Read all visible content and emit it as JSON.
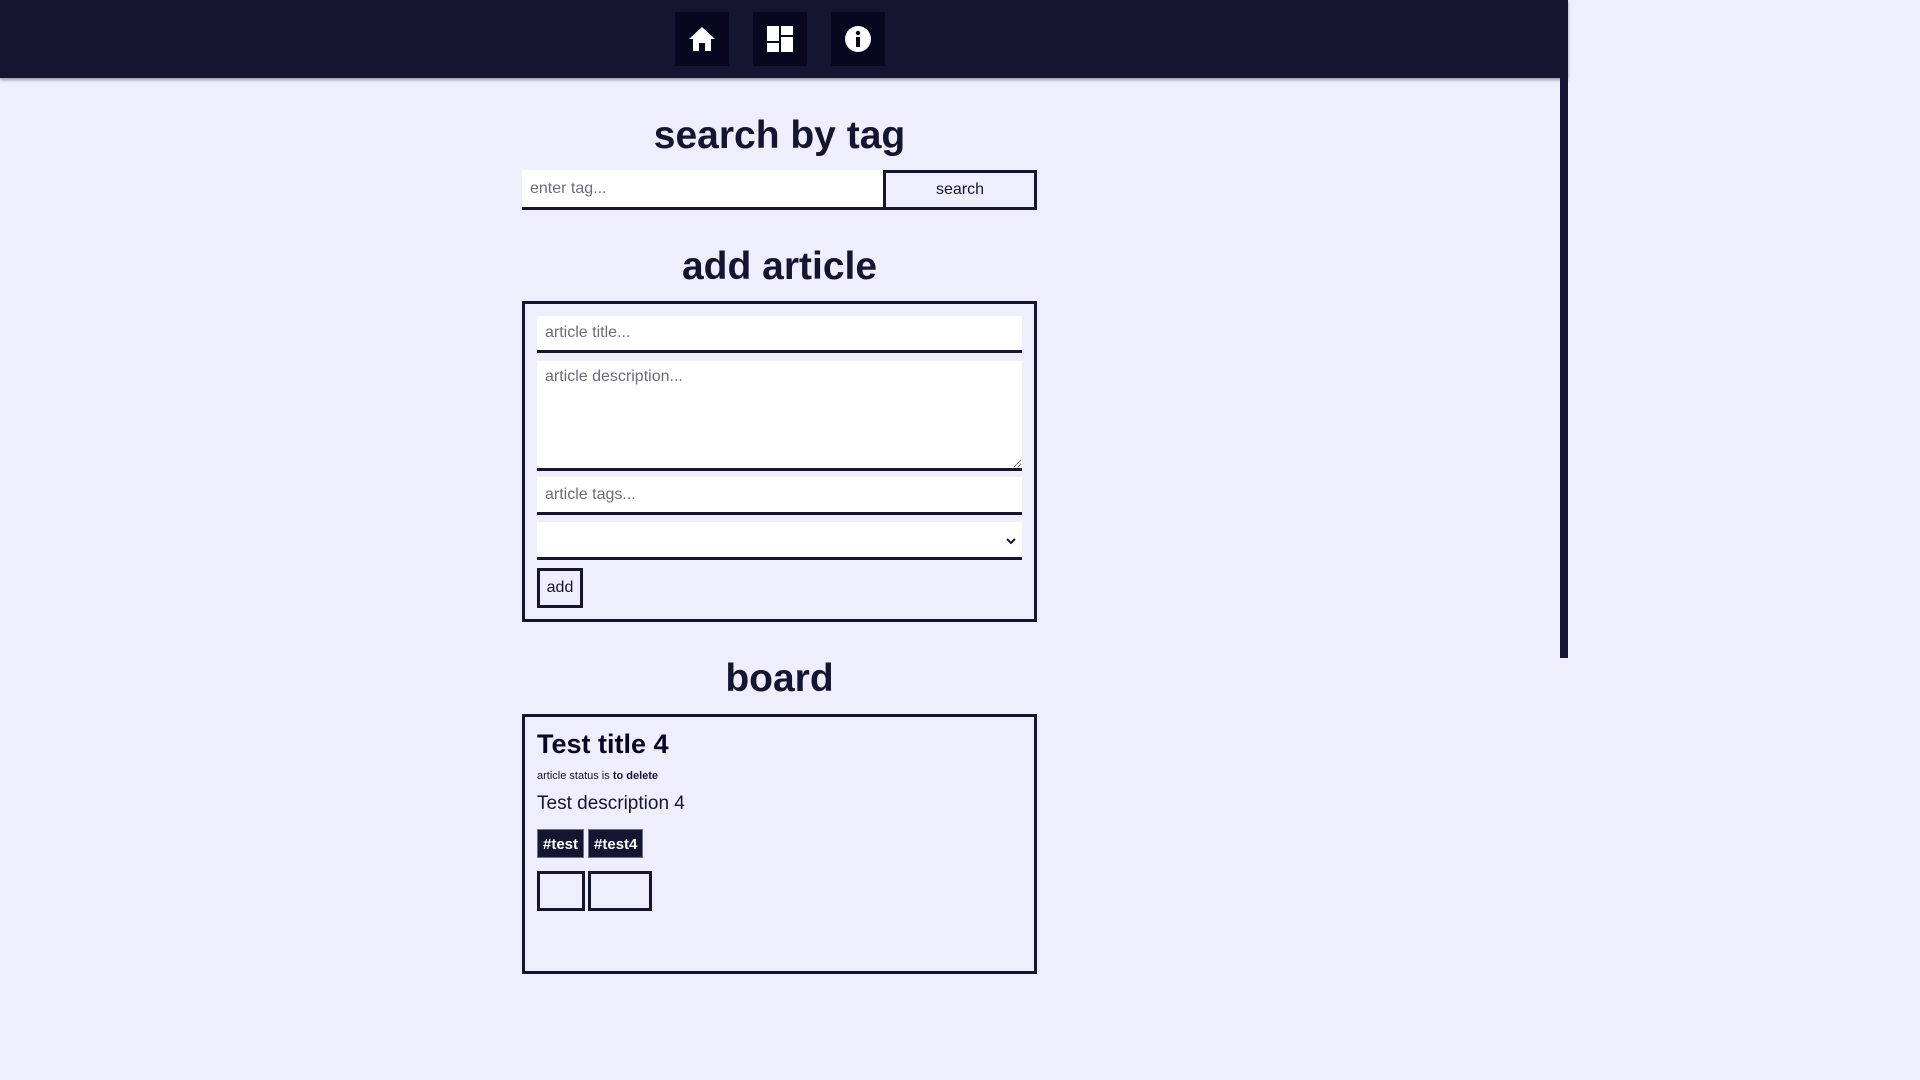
{
  "nav": {
    "items": [
      {
        "name": "home",
        "icon": "home-icon"
      },
      {
        "name": "board",
        "icon": "dashboard-icon"
      },
      {
        "name": "info",
        "icon": "info-icon"
      }
    ]
  },
  "search": {
    "title": "search by tag",
    "placeholder": "enter tag...",
    "button_label": "search"
  },
  "add_article": {
    "title": "add article",
    "title_placeholder": "article title...",
    "description_placeholder": "article description...",
    "tags_placeholder": "article tags...",
    "status_value": "",
    "add_label": "add"
  },
  "board": {
    "title": "board",
    "articles": [
      {
        "title": "Test title 4",
        "status_prefix": "article status is",
        "status": "to delete",
        "description": "Test description 4",
        "tags": [
          "#test",
          "#test4"
        ]
      }
    ]
  },
  "colors": {
    "navy": "#141530",
    "background": "#eeeefc",
    "button_dark": "#07081f"
  }
}
